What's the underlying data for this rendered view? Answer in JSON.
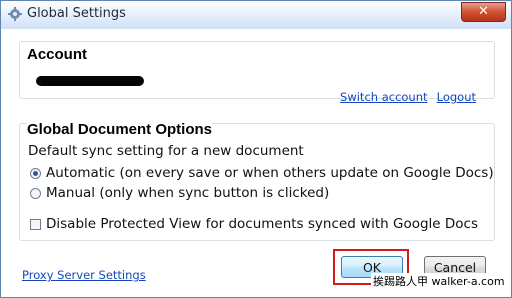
{
  "window": {
    "title": "Global Settings",
    "close_label": "✕"
  },
  "account": {
    "title": "Account",
    "switch_account": "Switch account",
    "logout": "Logout"
  },
  "options": {
    "title": "Global Document Options",
    "default_sync_label": "Default sync setting for a new document",
    "radio_automatic": "Automatic (on every save or when others update on Google Docs)",
    "radio_manual": "Manual (only when sync button is clicked)",
    "selected": "automatic",
    "disable_protected_view": "Disable Protected View for documents synced with Google Docs",
    "disable_protected_view_checked": false
  },
  "footer": {
    "proxy_link": "Proxy Server Settings",
    "ok_label": "OK",
    "cancel_label": "Cancel"
  },
  "watermark": "挨踢路人甲 walker-a.com",
  "colors": {
    "link": "#1545c0",
    "highlight": "#d11b1b"
  }
}
